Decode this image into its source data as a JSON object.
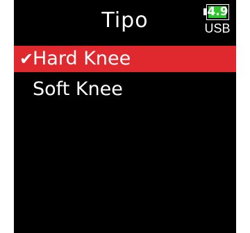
{
  "header": {
    "title": "Tipo",
    "battery_level": "4.9",
    "power_source": "USB",
    "battery_fill_fraction": 0.95,
    "icons": {
      "battery": "battery-icon"
    }
  },
  "menu": {
    "items": [
      {
        "label": "Hard Knee",
        "checkmark": "✔",
        "selected": true
      },
      {
        "label": "Soft Knee",
        "checkmark": "",
        "selected": false
      }
    ]
  },
  "colors": {
    "background": "#000000",
    "selection": "#e0282f",
    "battery_fill": "#2ec52e",
    "text": "#ffffff"
  }
}
